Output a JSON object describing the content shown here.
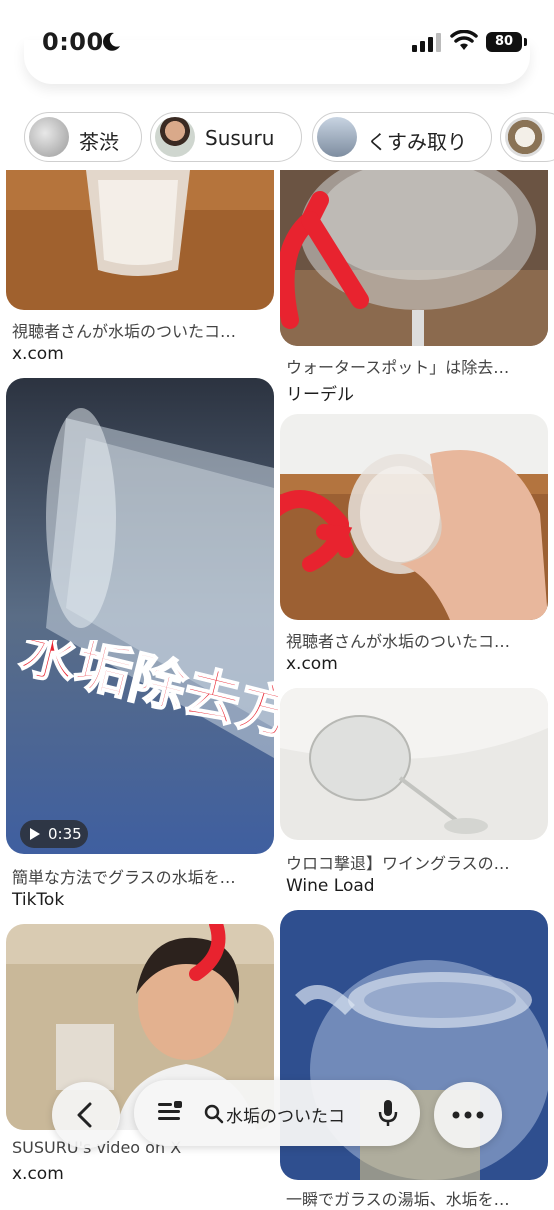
{
  "status_bar": {
    "time": "0:00",
    "battery": "80"
  },
  "chips": [
    {
      "label": "茶渋"
    },
    {
      "label": "Susuru"
    },
    {
      "label": "くすみ取り"
    }
  ],
  "results": [
    {
      "caption": "視聴者さんが水垢のついたコ…",
      "source": "x.com"
    },
    {
      "caption": "ウォータースポット」は除去…",
      "source": "リーデル"
    },
    {
      "caption": "簡単な方法でグラスの水垢を…",
      "source": "TikTok",
      "duration": "0:35",
      "overlay_text": "水垢除去方"
    },
    {
      "caption": "視聴者さんが水垢のついたコ…",
      "source": "x.com"
    },
    {
      "caption": "ウロコ撃退】ワイングラスの…",
      "source": "Wine Load"
    },
    {
      "caption": "SUSURU's video on X",
      "source": "x.com"
    },
    {
      "caption": "一瞬でガラスの湯垢、水垢を…",
      "source": ""
    }
  ],
  "toolbar": {
    "query": "水垢のついたコ"
  }
}
